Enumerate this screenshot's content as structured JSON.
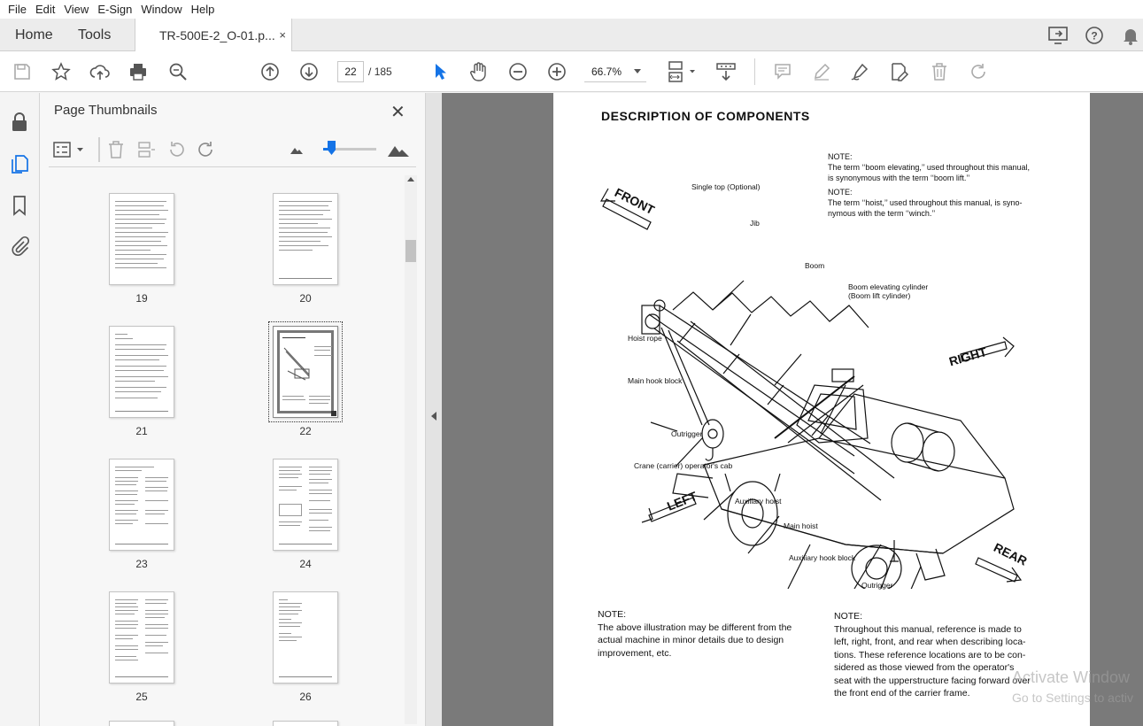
{
  "menu": [
    "File",
    "Edit",
    "View",
    "E-Sign",
    "Window",
    "Help"
  ],
  "tabs": {
    "home": "Home",
    "tools": "Tools",
    "document": "TR-500E-2_O-01.p...",
    "close": "×"
  },
  "toolbar": {
    "page_current": "22",
    "page_separator": "/",
    "page_total": "185",
    "zoom": "66.7%"
  },
  "panel": {
    "title": "Page Thumbnails",
    "close": "✕",
    "thumbnails": [
      {
        "label": "19"
      },
      {
        "label": "20"
      },
      {
        "label": "21"
      },
      {
        "label": "22",
        "selected": true
      },
      {
        "label": "23"
      },
      {
        "label": "24"
      },
      {
        "label": "25"
      },
      {
        "label": "26"
      }
    ]
  },
  "document": {
    "title": "DESCRIPTION OF COMPONENTS",
    "note1_head": "NOTE:",
    "note1_l1": "The term ‘‘boom elevating,’’ used throughout this manual,",
    "note1_l2": "is synonymous with the term ‘‘boom lift.’’",
    "note2_head": "NOTE:",
    "note2_l1": "The term ‘‘hoist,’’ used throughout this manual, is syno-",
    "note2_l2": "nymous with the term ‘‘winch.’’",
    "labels": {
      "single_top": "Single top (Optional)",
      "jib": "Jib",
      "boom": "Boom",
      "boom_cyl_1": "Boom elevating cylinder",
      "boom_cyl_2": "(Boom lift cylinder)",
      "hoist_rope": "Hoist rope",
      "main_hook": "Main hook block",
      "outrigger_left": "Outrigger",
      "cab": "Crane (carrier) operator's cab",
      "aux_hoist": "Auxiliary hoist",
      "main_hoist": "Main hoist",
      "aux_hook": "Auxiliary hook block",
      "outrigger_bottom": "Outrigger"
    },
    "directions": {
      "front": "FRONT",
      "right": "RIGHT",
      "left": "LEFT",
      "rear": "REAR"
    },
    "bottom_note_left": {
      "head": "NOTE:",
      "l1": "The above illustration may be different from the",
      "l2": "actual machine in minor details due to design",
      "l3": "improvement, etc."
    },
    "bottom_note_right": {
      "head": "NOTE:",
      "l1": "Throughout this manual, reference is made to",
      "l2": "left, right, front, and rear when describing loca-",
      "l3": "tions. These reference locations are to be con-",
      "l4": "sidered as those viewed from the operator's",
      "l5": "seat with the upperstructure facing forward over",
      "l6": "the front end of the carrier frame."
    }
  },
  "watermark": {
    "line1": "Activate Window",
    "line2": "Go to Settings to activ"
  }
}
